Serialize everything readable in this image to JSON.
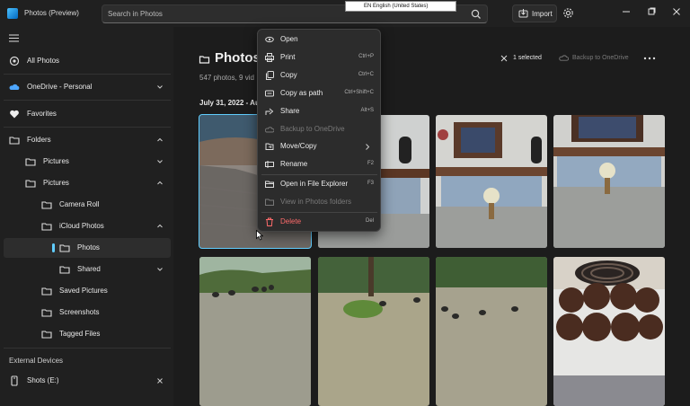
{
  "titlebar": {
    "app_title": "Photos (Preview)",
    "search_placeholder": "Search in Photos",
    "import_label": "Import",
    "language_tooltip": "EN English (United States)"
  },
  "sidebar": {
    "items": [
      {
        "label": "All Photos",
        "icon": "photos-icon"
      },
      {
        "label": "OneDrive - Personal",
        "icon": "cloud-icon"
      },
      {
        "label": "Favorites",
        "icon": "heart-icon"
      },
      {
        "label": "Folders",
        "icon": "folder-icon"
      },
      {
        "label": "Pictures",
        "icon": "folder-icon"
      },
      {
        "label": "Pictures",
        "icon": "folder-icon"
      },
      {
        "label": "Camera Roll",
        "icon": "folder-icon"
      },
      {
        "label": "iCloud Photos",
        "icon": "folder-icon"
      },
      {
        "label": "Photos",
        "icon": "folder-icon",
        "selected": true
      },
      {
        "label": "Shared",
        "icon": "folder-icon"
      },
      {
        "label": "Saved Pictures",
        "icon": "folder-icon"
      },
      {
        "label": "Screenshots",
        "icon": "folder-icon"
      },
      {
        "label": "Tagged Files",
        "icon": "folder-icon"
      }
    ],
    "external_devices_label": "External Devices",
    "device": {
      "label": "Shots (E:)",
      "icon": "usb-drive-icon"
    }
  },
  "main": {
    "title": "Photos",
    "subtitle": "547 photos, 9 vid",
    "date_header": "July 31, 2022 - Au",
    "selected_label": "1 selected",
    "backup_label": "Backup to OneDrive"
  },
  "context_menu": {
    "items": [
      {
        "label": "Open",
        "shortcut": "",
        "icon": "open-icon",
        "enabled": true
      },
      {
        "label": "Print",
        "shortcut": "Ctrl+P",
        "icon": "print-icon",
        "enabled": true
      },
      {
        "label": "Copy",
        "shortcut": "Ctrl+C",
        "icon": "copy-icon",
        "enabled": true
      },
      {
        "label": "Copy as path",
        "shortcut": "Ctrl+Shift+C",
        "icon": "copy-path-icon",
        "enabled": true
      },
      {
        "label": "Share",
        "shortcut": "Alt+S",
        "icon": "share-icon",
        "enabled": true
      },
      {
        "label": "Backup to OneDrive",
        "shortcut": "",
        "icon": "cloud-sync-icon",
        "enabled": false
      },
      {
        "label": "Move/Copy",
        "shortcut": "",
        "icon": "move-copy-icon",
        "enabled": true
      },
      {
        "label": "Rename",
        "shortcut": "F2",
        "icon": "rename-icon",
        "enabled": true
      },
      {
        "label": "Open in File Explorer",
        "shortcut": "F3",
        "icon": "file-explorer-icon",
        "enabled": true
      },
      {
        "label": "View in Photos folders",
        "shortcut": "",
        "icon": "photos-folder-icon",
        "enabled": false
      },
      {
        "label": "Delete",
        "shortcut": "Del",
        "icon": "trash-icon",
        "enabled": true
      }
    ]
  },
  "colors": {
    "accent": "#60cdff",
    "delete": "#ff6b6b"
  }
}
